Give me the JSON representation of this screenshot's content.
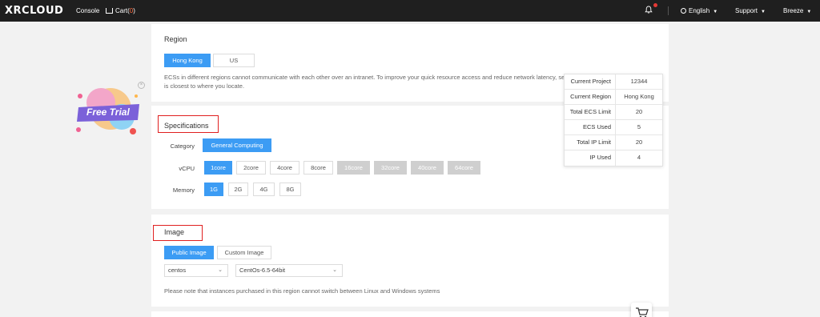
{
  "topbar": {
    "logo": "XRCLOUD",
    "console": "Console",
    "cart_label": "Cart(",
    "cart_count": "0",
    "cart_close": ")",
    "language": "English",
    "support": "Support",
    "user": "Breeze"
  },
  "region": {
    "title": "Region",
    "options": [
      "Hong Kong",
      "US"
    ],
    "selected": "Hong Kong",
    "note_line1": "ECSs in different regions cannot communicate with each other over an intranet. To improve your quick resource access and reduce network latency, select the region that",
    "note_line2": "is closest to where you locate."
  },
  "specifications": {
    "title": "Specifications",
    "category_label": "Category",
    "category_value": "General Computing",
    "vcpu_label": "vCPU",
    "vcpu_options": [
      "1core",
      "2core",
      "4core",
      "8core",
      "16core",
      "32core",
      "40core",
      "64core"
    ],
    "memory_label": "Memory",
    "memory_options": [
      "1G",
      "2G",
      "4G",
      "8G"
    ]
  },
  "image": {
    "title": "Image",
    "tabs": [
      "Public Image",
      "Custom Image"
    ],
    "os_select": "centos",
    "version_select": "CentOs-6.5-64bit",
    "note": "Please note that instances purchased in this region cannot switch between Linux and Windows systems"
  },
  "info": {
    "rows": [
      {
        "k": "Current Project",
        "v": "12344"
      },
      {
        "k": "Current Region",
        "v": "Hong Kong"
      },
      {
        "k": "Total ECS Limit",
        "v": "20"
      },
      {
        "k": "ECS Used",
        "v": "5"
      },
      {
        "k": "Total IP Limit",
        "v": "20"
      },
      {
        "k": "IP Used",
        "v": "4"
      }
    ]
  },
  "free_trial": {
    "label": "Free Trial"
  },
  "colors": {
    "primary": "#3c9cf4",
    "highlight": "#e02020",
    "topbar": "#1f1f1f",
    "disabled": "#cfcfcf"
  },
  "icons": [
    "bell-icon",
    "globe-icon",
    "cart-icon",
    "chevron-down-icon",
    "close-icon"
  ]
}
